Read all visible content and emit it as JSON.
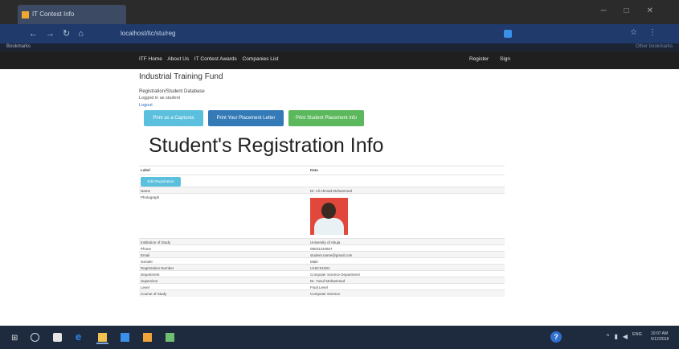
{
  "browser": {
    "tab_title": "IT Contest Info",
    "url": "localhost/itc/stu/reg",
    "bookmarks_left": "Bookmarks",
    "bookmarks_right": "Other bookmarks"
  },
  "navbar": {
    "links": [
      "ITF Home",
      "About Us",
      "IT Contest Awards",
      "Companies List"
    ],
    "right_links": [
      "Register",
      "Sign"
    ]
  },
  "page": {
    "site_title": "Industrial Training Fund",
    "system_title": "Registration/Student Database",
    "logged_in": "Logged in as student",
    "logout": "Logout",
    "buttons": {
      "print": "Print as a Captures",
      "letter": "Print Your Placement Letter",
      "all": "Print Student Placement info"
    },
    "heading": "Student's Registration Info"
  },
  "table": {
    "header": [
      "Label",
      "Data"
    ],
    "register_button": "Edit Registration",
    "rows": [
      {
        "label": "Name",
        "value": "Dr. Ali Ahmad Mohammed"
      },
      {
        "label": "Photograph",
        "value": ""
      },
      {
        "label": "Institution of Study",
        "value": "University of Abuja"
      },
      {
        "label": "Phone",
        "value": "08031234567"
      },
      {
        "label": "Email",
        "value": "student.name@gmail.com"
      },
      {
        "label": "Gender",
        "value": "Male"
      },
      {
        "label": "Registration Number",
        "value": "U16CS1001"
      },
      {
        "label": "Department",
        "value": "Computer Science Department"
      },
      {
        "label": "Supervisor",
        "value": "Dr. Yusuf Mohammed"
      },
      {
        "label": "Level",
        "value": "Final Level"
      },
      {
        "label": "Course of Study",
        "value": "Computer Science"
      }
    ]
  },
  "taskbar": {
    "language": "ENG",
    "time": "10:07 AM",
    "date": "5/12/2018"
  }
}
